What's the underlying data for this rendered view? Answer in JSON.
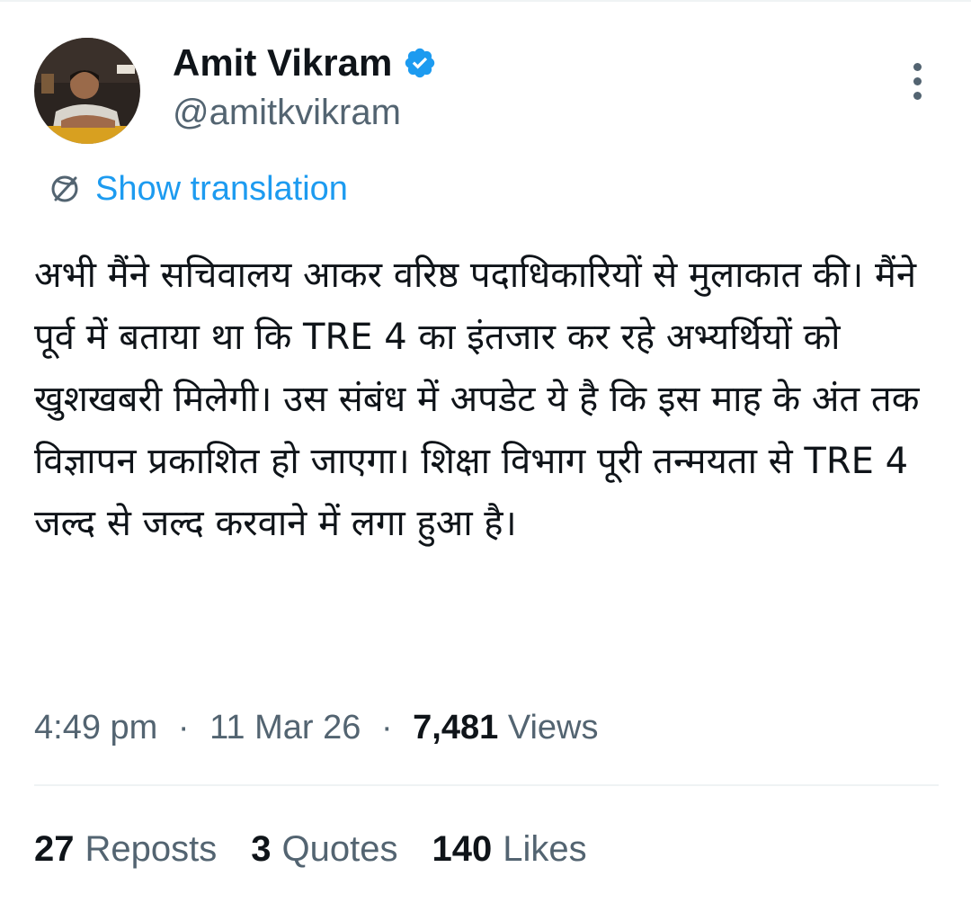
{
  "author": {
    "name": "Amit Vikram",
    "handle": "@amitkvikram",
    "verified": true,
    "verified_color": "#1d9bf0",
    "avatar_icon": "profile-photo"
  },
  "actions": {
    "more_icon": "more-vertical-icon"
  },
  "translation": {
    "label": "Show translation",
    "icon": "translate-globe-icon",
    "color": "#1d9bf0"
  },
  "tweet": {
    "text": "अभी मैंने सचिवालय आकर वरिष्ठ पदाधिकारियों से मुलाकात की। मैंने पूर्व में बताया था कि TRE 4 का इंतजार कर रहे अभ्यर्थियों को खुशखबरी मिलेगी। उस संबंध में अपडेट ये है कि इस माह के अंत तक विज्ञापन प्रकाशित हो जाएगा। शिक्षा विभाग पूरी तन्मयता से TRE 4 जल्द से जल्द करवाने में लगा हुआ है।"
  },
  "meta": {
    "time": "4:49 pm",
    "date": "11 Mar 26",
    "views_count": "7,481",
    "views_label": "Views",
    "separator": "·"
  },
  "stats": {
    "reposts_count": "27",
    "reposts_label": "Reposts",
    "quotes_count": "3",
    "quotes_label": "Quotes",
    "likes_count": "140",
    "likes_label": "Likes"
  }
}
